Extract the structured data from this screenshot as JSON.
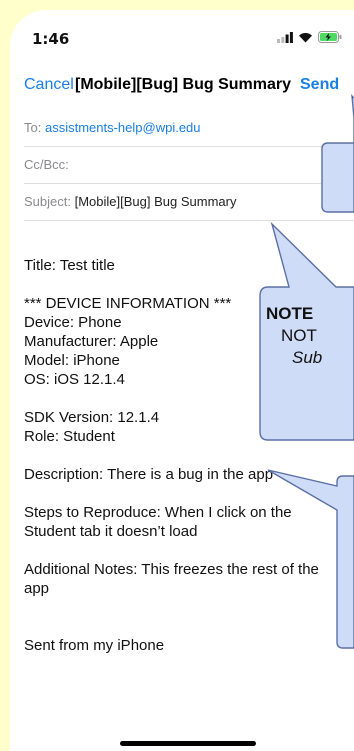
{
  "status": {
    "time": "1:46",
    "icons": [
      "signal-icon",
      "wifi-icon",
      "battery-charging-icon"
    ]
  },
  "nav": {
    "cancel": "Cancel",
    "title": "[Mobile][Bug] Bug Summary",
    "send": "Send"
  },
  "fields": {
    "to_label": "To:",
    "to_value": "assistments-help@wpi.edu",
    "cc_label": "Cc/Bcc:",
    "subject_label": "Subject:",
    "subject_value": "[Mobile][Bug] Bug Summary"
  },
  "body_lines": [
    "Title: Test title",
    "",
    "*** DEVICE INFORMATION ***",
    "Device: Phone",
    "Manufacturer: Apple",
    "Model: iPhone",
    "OS: iOS 12.1.4",
    "",
    "SDK Version: 12.1.4",
    "Role: Student",
    "",
    "Description: There is a bug in the app",
    "",
    "Steps to Reproduce: When I click on the",
    "Student tab it doesn’t load",
    "",
    "Additional Notes: This freezes the rest of the",
    "app",
    "",
    "",
    "Sent from my iPhone"
  ],
  "callouts": {
    "note_bold": "NOTE",
    "note_line2": "NOT",
    "note_line3": "Sub"
  },
  "colors": {
    "accent": "#1a7fe6",
    "page_bg": "#ffffcc",
    "callout_fill": "#cfdcf7",
    "callout_stroke": "#5b6fa6"
  }
}
